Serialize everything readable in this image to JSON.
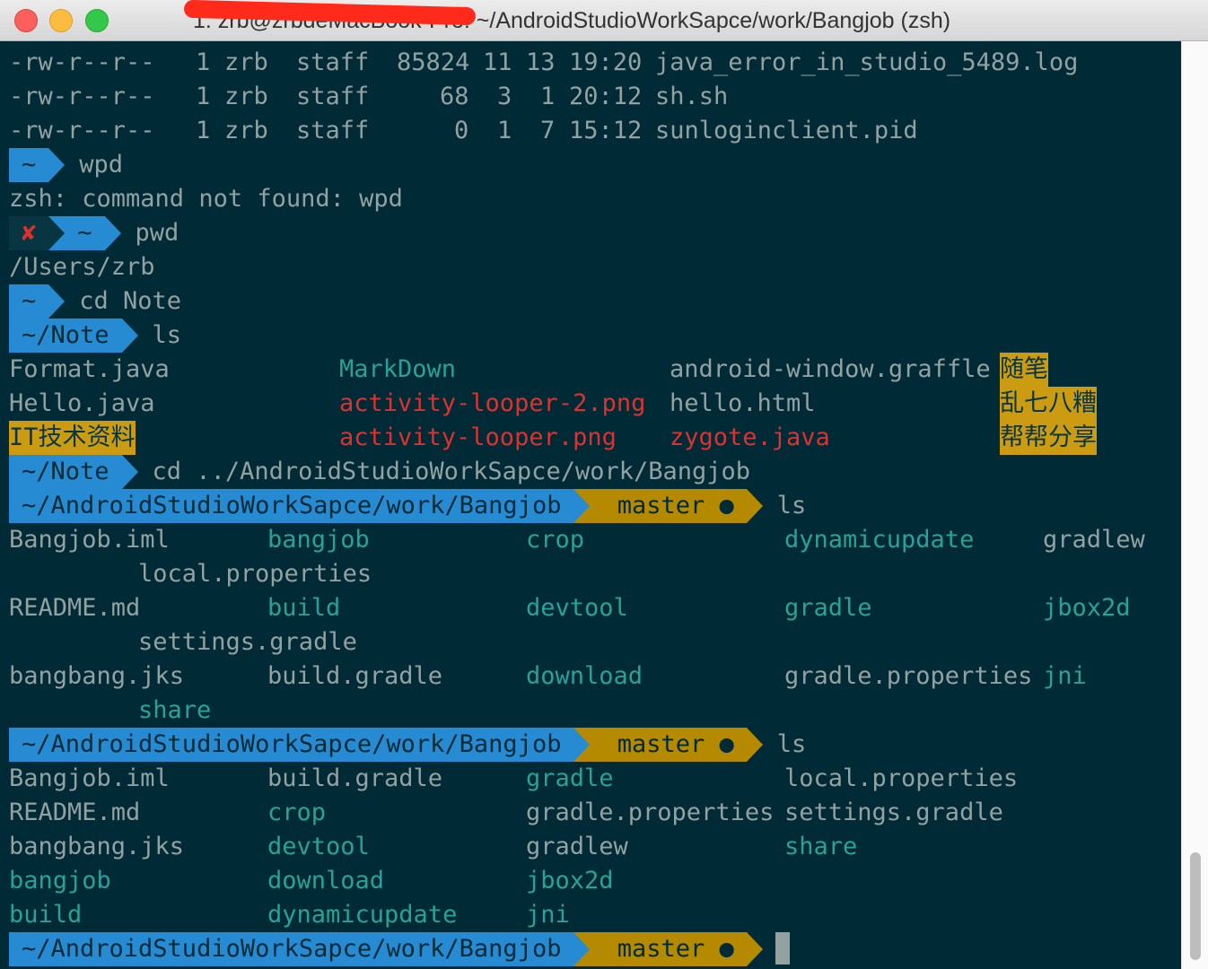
{
  "window": {
    "title": "1. zrb@zrbdeMacBook-Pro: ~/AndroidStudioWorkSapce/work/Bangjob (zsh)"
  },
  "ls_long": [
    {
      "perm": "-rw-r--r--",
      "links": "1",
      "user": "zrb",
      "group": "staff",
      "size": "85824",
      "month": "11",
      "day": "13",
      "time": "19:20",
      "name": "java_error_in_studio_5489.log"
    },
    {
      "perm": "-rw-r--r--",
      "links": "1",
      "user": "zrb",
      "group": "staff",
      "size": "68",
      "month": "3",
      "day": "1",
      "time": "20:12",
      "name": "sh.sh"
    },
    {
      "perm": "-rw-r--r--",
      "links": "1",
      "user": "zrb",
      "group": "staff",
      "size": "0",
      "month": "1",
      "day": "7",
      "time": "15:12",
      "name": "sunloginclient.pid"
    }
  ],
  "session": {
    "p1_dir": "~",
    "p1_cmd": "wpd",
    "err_line": "zsh: command not found: wpd",
    "fail_mark": "✘",
    "p2_dir": "~",
    "p2_cmd": "pwd",
    "pwd_out": "/Users/zrb",
    "p3_dir": "~",
    "p3_cmd": "cd Note",
    "p4_dir": "~/Note",
    "p4_cmd": "ls",
    "note_ls": {
      "r1": [
        "Format.java",
        "MarkDown",
        "android-window.graffle",
        "随笔"
      ],
      "r2": [
        "Hello.java",
        "activity-looper-2.png",
        "hello.html",
        "乱七八糟"
      ],
      "r3": [
        "IT技术资料",
        "activity-looper.png",
        "zygote.java",
        "帮帮分享"
      ]
    },
    "p5_dir": "~/Note",
    "p5_cmd": "cd ../AndroidStudioWorkSapce/work/Bangjob",
    "bang_dir": "~/AndroidStudioWorkSapce/work/Bangjob",
    "branch_icon": "",
    "branch": "master ●",
    "p6_cmd": "ls",
    "ls1": {
      "r1": [
        "Bangjob.iml",
        "bangjob",
        "crop",
        "dynamicupdate",
        "gradlew"
      ],
      "r1b": "local.properties",
      "r2": [
        "README.md",
        "build",
        "devtool",
        "gradle",
        "jbox2d"
      ],
      "r2b": "settings.gradle",
      "r3": [
        "bangbang.jks",
        "build.gradle",
        "download",
        "gradle.properties",
        "jni"
      ],
      "r3b": "share"
    },
    "p7_cmd": "ls",
    "ls2": {
      "r1": [
        "Bangjob.iml",
        "build.gradle",
        "gradle",
        "local.properties"
      ],
      "r2": [
        "README.md",
        "crop",
        "gradle.properties",
        "settings.gradle"
      ],
      "r3": [
        "bangbang.jks",
        "devtool",
        "gradlew",
        "share"
      ],
      "r4": [
        "bangjob",
        "download",
        "jbox2d"
      ],
      "r5": [
        "build",
        "dynamicupdate",
        "jni"
      ]
    }
  },
  "colors": {
    "background": "#002b36",
    "prompt_blue": "#268bd2",
    "prompt_yellow": "#b58900",
    "directory": "#2aa198",
    "error_red": "#dc322f"
  }
}
